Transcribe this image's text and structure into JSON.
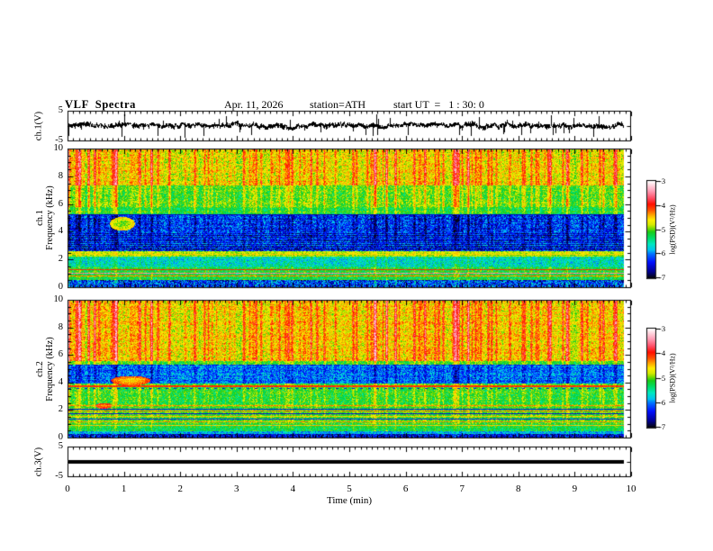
{
  "header": {
    "title": "VLF  Spectra",
    "date": "Apr. 11, 2026",
    "station": "station=ATH",
    "start_ut": "start UT  =   1 : 30: 0"
  },
  "xaxis": {
    "label": "Time  (min)",
    "tick_labels": [
      "0",
      "1",
      "2",
      "3",
      "4",
      "5",
      "6",
      "7",
      "8",
      "9",
      "10"
    ],
    "range_min": [
      0,
      10
    ],
    "minor_step_min": 0.1
  },
  "panels": {
    "wave1": {
      "ylabel": "ch.1(V)",
      "ytick_top": "5",
      "ytick_bottom": "-5"
    },
    "spec1": {
      "ylabel_line1": "ch.1",
      "ylabel_line2": "Frequency  (kHz)",
      "ytick_labels": [
        "10",
        "8",
        "6",
        "4",
        "2",
        "0"
      ]
    },
    "spec2": {
      "ylabel_line1": "ch.2",
      "ylabel_line2": "Frequency  (kHz)",
      "ytick_labels": [
        "10",
        "8",
        "6",
        "4",
        "2",
        "0"
      ]
    },
    "wave3": {
      "ylabel": "ch.3(V)",
      "ytick_top": "5",
      "ytick_bottom": "-5"
    }
  },
  "colorbar": {
    "label": "log(PSD)(V²/Hz)",
    "tick_labels": [
      "-3",
      "-4",
      "-5",
      "-6",
      "-7"
    ],
    "range": [
      -3,
      -7
    ]
  },
  "colormap_stops": [
    [
      -7.0,
      "#06060f"
    ],
    [
      -6.75,
      "#000090"
    ],
    [
      -6.35,
      "#0010ff"
    ],
    [
      -6.0,
      "#0077ff"
    ],
    [
      -5.85,
      "#00c4f0"
    ],
    [
      -5.6,
      "#00e8c0"
    ],
    [
      -5.35,
      "#00dd66"
    ],
    [
      -5.1,
      "#19cc19"
    ],
    [
      -4.95,
      "#7edd00"
    ],
    [
      -4.8,
      "#d6ea00"
    ],
    [
      -4.6,
      "#ffee00"
    ],
    [
      -4.4,
      "#ffa800"
    ],
    [
      -4.2,
      "#ff5500"
    ],
    [
      -3.95,
      "#ff0f00"
    ],
    [
      -3.7,
      "#ff4e66"
    ],
    [
      -3.4,
      "#ff9fb7"
    ],
    [
      -3.15,
      "#ffd9e2"
    ],
    [
      -3.0,
      "#ffffff"
    ]
  ],
  "chart_data": [
    {
      "type": "line",
      "name": "ch1_waveform",
      "ylabel": "ch.1(V)",
      "ylim": [
        -5,
        5
      ],
      "x_range_min": [
        0,
        9.86
      ],
      "signal": {
        "mean": 0,
        "std": 0.45,
        "spike_probability": 0.08,
        "spike_min_v": 1.2,
        "spike_range_v": 3.4,
        "negative_spike_bias": 0.6,
        "color": "#000000"
      }
    },
    {
      "type": "heatmap",
      "name": "ch1_spectrogram",
      "ylabel": "ch.1 Frequency (kHz)",
      "ylim": [
        0,
        10
      ],
      "x_range_min": [
        0,
        9.86
      ],
      "value_units": "log(PSD)(V²/Hz)",
      "value_range": [
        -7,
        -3
      ],
      "bands": [
        {
          "f": [
            7.4,
            10.0
          ],
          "base": -4.9,
          "gain": 1.05,
          "noise": 0.38
        },
        {
          "f": [
            5.8,
            7.4
          ],
          "base": -5.25,
          "gain": 0.85,
          "noise": 0.33
        },
        {
          "f": [
            5.3,
            5.8
          ],
          "base": -5.35,
          "gain": 0.55,
          "noise": 0.3
        },
        {
          "f": [
            3.95,
            5.3
          ],
          "base": -6.1,
          "gain": -0.65,
          "noise": 0.5
        },
        {
          "f": [
            3.0,
            3.95
          ],
          "base": -6.15,
          "gain": -0.4,
          "noise": 0.45,
          "stripes": 0.3
        },
        {
          "f": [
            2.6,
            3.0
          ],
          "base": -6.3,
          "gain": -0.2,
          "noise": 0.5,
          "stripes": 0.35
        },
        {
          "f": [
            2.2,
            2.6
          ],
          "base": -4.95,
          "gain": 0.25,
          "noise": 0.25
        },
        {
          "f": [
            1.4,
            2.2
          ],
          "base": -5.7,
          "gain": 0.3,
          "noise": 0.4
        },
        {
          "f": [
            0.5,
            1.4
          ],
          "base": -5.3,
          "gain": 0.25,
          "noise": 0.3
        },
        {
          "f": [
            0.0,
            0.5
          ],
          "base": -6.45,
          "gain": 0.45,
          "noise": 0.65
        }
      ],
      "hlines": [
        {
          "f": 5.27,
          "level": -6.6
        },
        {
          "f": 2.4,
          "level": -4.55
        },
        {
          "f": 1.25,
          "level": -4.0
        },
        {
          "f": 1.0,
          "level": -3.5
        },
        {
          "f": 0.8,
          "level": -4.3
        }
      ],
      "patches": [
        {
          "t": 0.95,
          "f": 4.6,
          "rt": 0.22,
          "rf": 0.5,
          "level": -5.0
        }
      ]
    },
    {
      "type": "heatmap",
      "name": "ch2_spectrogram",
      "ylabel": "ch.2 Frequency (kHz)",
      "ylim": [
        0,
        10
      ],
      "x_range_min": [
        0,
        9.86
      ],
      "value_units": "log(PSD)(V²/Hz)",
      "value_range": [
        -7,
        -3
      ],
      "bands": [
        {
          "f": [
            5.6,
            10.0
          ],
          "base": -4.85,
          "gain": 1.05,
          "noise": 0.38
        },
        {
          "f": [
            5.35,
            5.6
          ],
          "base": -5.3,
          "gain": 0.6,
          "noise": 0.3
        },
        {
          "f": [
            3.95,
            5.35
          ],
          "base": -5.9,
          "gain": -0.5,
          "noise": 0.45
        },
        {
          "f": [
            2.45,
            3.95
          ],
          "base": -5.3,
          "gain": 0.55,
          "noise": 0.33
        },
        {
          "f": [
            0.95,
            2.45
          ],
          "base": -5.15,
          "gain": 0.3,
          "noise": 0.3
        },
        {
          "f": [
            0.45,
            0.95
          ],
          "base": -5.35,
          "gain": 0.25,
          "noise": 0.3
        },
        {
          "f": [
            0.2,
            0.45
          ],
          "base": -5.85,
          "gain": 0.2,
          "noise": 0.4
        },
        {
          "f": [
            0.0,
            0.2
          ],
          "base": -6.6,
          "gain": 0.3,
          "noise": 0.5
        }
      ],
      "hlines": [
        {
          "f": 5.3,
          "level": -6.5,
          "dash": [
            5,
            4
          ]
        },
        {
          "f": 3.75,
          "level": -4.05,
          "th": 2
        },
        {
          "f": 3.6,
          "level": -6.4,
          "dash": [
            3,
            6
          ]
        },
        {
          "f": 2.3,
          "level": -4.35
        },
        {
          "f": 2.05,
          "level": -6.4
        },
        {
          "f": 1.9,
          "level": -4.3
        },
        {
          "f": 1.7,
          "level": -6.5
        },
        {
          "f": 1.5,
          "level": -4.5
        },
        {
          "f": 1.3,
          "level": -6.3
        },
        {
          "f": 1.1,
          "level": -4.4
        },
        {
          "f": 0.85,
          "level": -4.5
        }
      ],
      "patches": [
        {
          "t": 1.1,
          "f": 4.15,
          "rt": 0.35,
          "rf": 0.35,
          "level": -4.55
        },
        {
          "t": 0.62,
          "f": 2.3,
          "rt": 0.15,
          "rf": 0.2,
          "level": -4.3
        }
      ]
    },
    {
      "type": "line",
      "name": "ch3_waveform",
      "ylabel": "ch.3(V)",
      "ylim": [
        -5,
        5
      ],
      "x_range_min": [
        0,
        9.86
      ],
      "signal": {
        "constant": 0,
        "bar_thickness_px": 4,
        "color": "#000000"
      }
    }
  ],
  "streaks": {
    "burst_prob": 0.17,
    "burst_min": 0.55,
    "burst_range": 1.5,
    "calm_range": 0.5
  }
}
